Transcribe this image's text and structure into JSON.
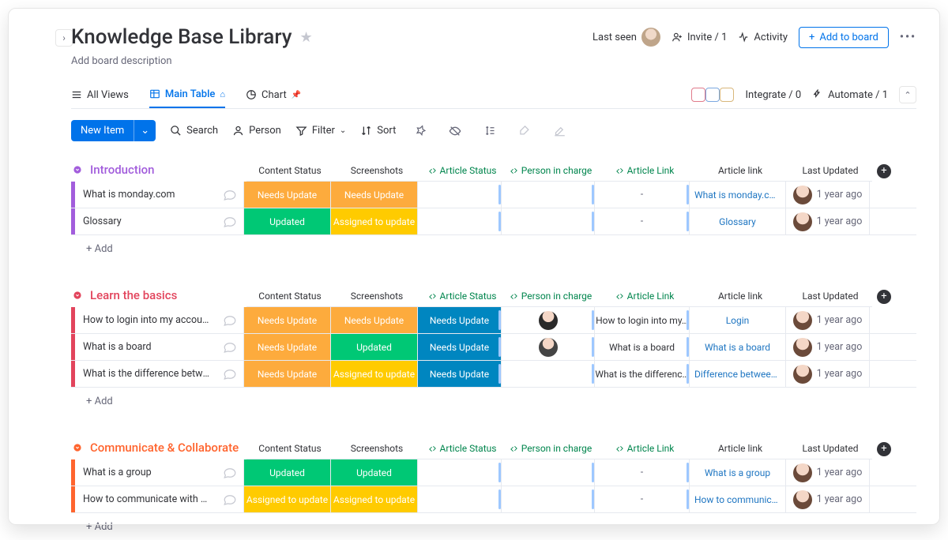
{
  "header": {
    "title": "Knowledge Base Library",
    "description": "Add board description",
    "last_seen": "Last seen",
    "invite": "Invite / 1",
    "activity": "Activity",
    "add_to_board": "Add to board"
  },
  "tabs": {
    "all_views": "All Views",
    "main_table": "Main Table",
    "chart": "Chart",
    "integrate": "Integrate / 0",
    "automate": "Automate / 1"
  },
  "toolbar": {
    "new_item": "New Item",
    "search": "Search",
    "person": "Person",
    "filter": "Filter",
    "sort": "Sort"
  },
  "text": {
    "add_row": "+ Add"
  },
  "columns": {
    "content_status": "Content Status",
    "screenshots": "Screenshots",
    "article_status": "Article Status",
    "person_in_charge": "Person in charge",
    "article_link_mirror": "Article Link",
    "article_link": "Article link",
    "last_updated": "Last Updated"
  },
  "status_labels": {
    "needs_update": "Needs Update",
    "updated": "Updated",
    "assigned": "Assigned to update"
  },
  "groups": [
    {
      "name": "Introduction",
      "color": "purple",
      "rows": [
        {
          "name": "What is monday.com",
          "content_status": "needs_update",
          "screenshots": "needs_update",
          "article_status": "",
          "person": "",
          "mirror_link": "-",
          "link": "What is monday.com",
          "updated": "1 year ago"
        },
        {
          "name": "Glossary",
          "content_status": "updated",
          "screenshots": "assigned",
          "article_status": "",
          "person": "",
          "mirror_link": "-",
          "link": "Glossary",
          "updated": "1 year ago"
        }
      ]
    },
    {
      "name": "Learn the basics",
      "color": "red",
      "rows": [
        {
          "name": "How to login into my account",
          "content_status": "needs_update",
          "screenshots": "needs_update",
          "article_status": "needs_update",
          "person": "p1",
          "mirror_link": "How to login into my…",
          "link": "Login",
          "updated": "1 year ago"
        },
        {
          "name": "What is a board",
          "content_status": "needs_update",
          "screenshots": "updated",
          "article_status": "needs_update",
          "person": "p2",
          "mirror_link": "What is a board",
          "link": "What is a board",
          "updated": "1 year ago"
        },
        {
          "name": "What is the difference between t…",
          "content_status": "needs_update",
          "screenshots": "assigned",
          "article_status": "needs_update",
          "person": "",
          "mirror_link": "What is the differenc…",
          "link": "Difference between …",
          "updated": "1 year ago"
        }
      ]
    },
    {
      "name": "Communicate & Collaborate",
      "color": "orange",
      "rows": [
        {
          "name": "What is a group",
          "content_status": "updated",
          "screenshots": "updated",
          "article_status": "",
          "person": "",
          "mirror_link": "-",
          "link": "What is a group",
          "updated": "1 year ago"
        },
        {
          "name": "How to communicate with my te…",
          "content_status": "assigned",
          "screenshots": "assigned",
          "article_status": "",
          "person": "",
          "mirror_link": "-",
          "link": "How to communicat…",
          "updated": "1 year ago"
        }
      ]
    }
  ]
}
